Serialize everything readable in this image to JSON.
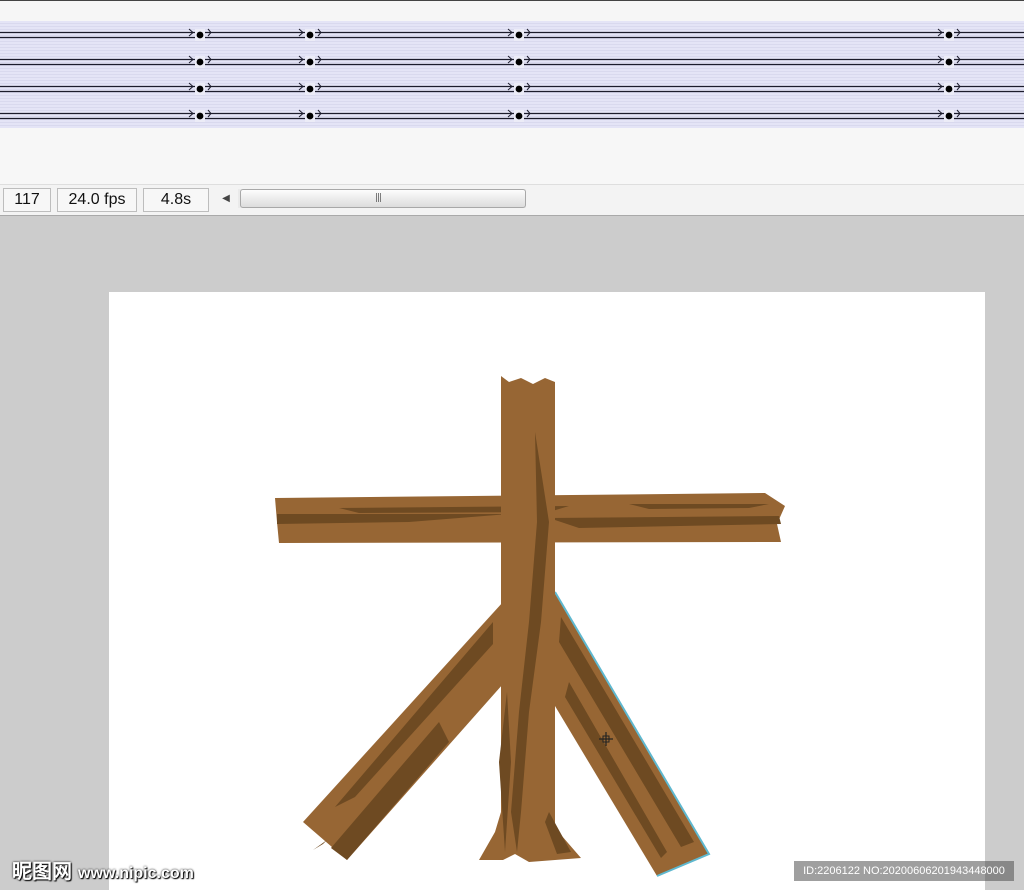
{
  "timeline": {
    "track_count": 4
  },
  "status_bar": {
    "frame": "117",
    "fps": "24.0 fps",
    "elapsed": "4.8s"
  },
  "stage": {
    "background": "#ffffff",
    "wood_color": "#976634",
    "wood_grain_color": "#6e4a22",
    "selection_color": "#5fb8cf"
  },
  "icons": [
    "tween-arrow-icon",
    "keyframe-dot-icon",
    "scroll-left-arrow-icon",
    "scroll-grip-icon",
    "move-cursor-icon"
  ],
  "watermark": {
    "logo_text": "昵图网",
    "url": "www.nipic.com",
    "id_text": "ID:2206122 NO:20200606201943448000"
  }
}
